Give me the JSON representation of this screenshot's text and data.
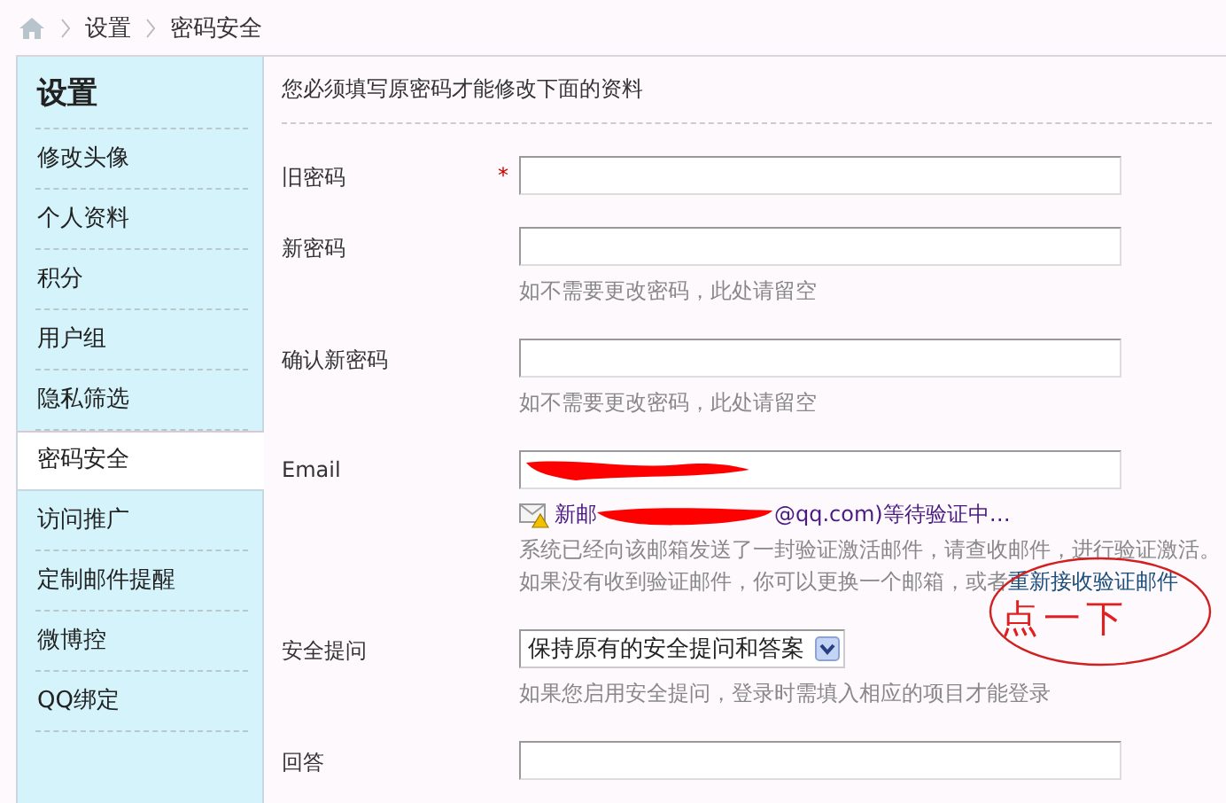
{
  "breadcrumb": [
    "设置",
    "密码安全"
  ],
  "sidebar": {
    "title": "设置",
    "items": [
      {
        "label": "修改头像",
        "selected": false
      },
      {
        "label": "个人资料",
        "selected": false
      },
      {
        "label": "积分",
        "selected": false
      },
      {
        "label": "用户组",
        "selected": false
      },
      {
        "label": "隐私筛选",
        "selected": false
      },
      {
        "label": "密码安全",
        "selected": true
      },
      {
        "label": "访问推广",
        "selected": false
      },
      {
        "label": "定制邮件提醒",
        "selected": false
      },
      {
        "label": "微博控",
        "selected": false
      },
      {
        "label": "QQ绑定",
        "selected": false
      }
    ]
  },
  "notice": "您必须填写原密码才能修改下面的资料",
  "required_symbol": "*",
  "fields": [
    {
      "kind": "password",
      "label": "旧密码",
      "required": true
    },
    {
      "kind": "password",
      "label": "新密码",
      "required": false,
      "hint": "如不需要更改密码，此处请留空"
    },
    {
      "kind": "password",
      "label": "确认新密码",
      "required": false,
      "hint": "如不需要更改密码，此处请留空"
    },
    {
      "kind": "email",
      "label": "Email",
      "required": false,
      "status_start": "新邮",
      "status_end": "@qq.com)等待验证中…",
      "lines": [
        "系统已经向该邮箱发送了一封验证激活邮件，请查收邮件，进行验证激活。",
        "如果没有收到验证邮件，你可以更换一个邮箱，或者"
      ],
      "link": "重新接收验证邮件",
      "annotation": "点一下"
    },
    {
      "kind": "select",
      "label": "安全提问",
      "required": false,
      "value": "保持原有的安全提问和答案",
      "hint": "如果您启用安全提问，登录时需填入相应的项目才能登录"
    },
    {
      "kind": "password",
      "label": "回答",
      "required": false
    }
  ]
}
